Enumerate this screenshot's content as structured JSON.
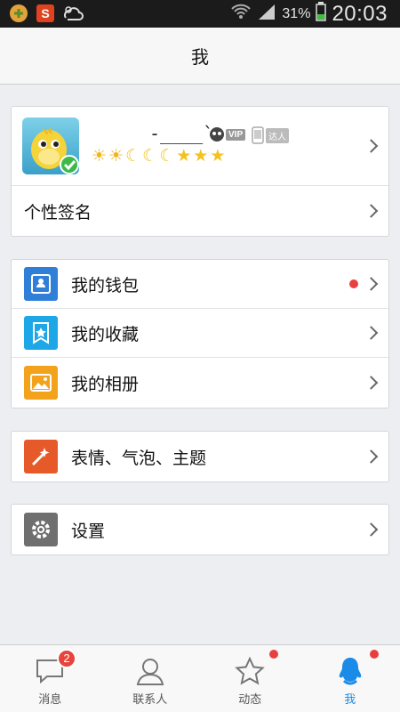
{
  "status_bar": {
    "battery_percent": "31%",
    "time": "20:03",
    "battery_level": 0.31
  },
  "header": {
    "title": "我"
  },
  "profile": {
    "nickname": "-____`",
    "vip_badge": "VIP",
    "talent_badge": "达人",
    "signature_label": "个性签名"
  },
  "menu": {
    "wallet": "我的钱包",
    "favorites": "我的收藏",
    "album": "我的相册",
    "emoji_themes": "表情、气泡、主题",
    "settings": "设置"
  },
  "tabs": [
    {
      "label": "消息",
      "icon": "message-icon",
      "badge": "2"
    },
    {
      "label": "联系人",
      "icon": "contacts-icon"
    },
    {
      "label": "动态",
      "icon": "star-icon",
      "dot": true
    },
    {
      "label": "我",
      "icon": "penguin-icon",
      "dot": true,
      "active": true
    }
  ],
  "colors": {
    "accent": "#1a8ce8",
    "wallet_icon_bg": "#2f7fd8",
    "favorites_icon_bg": "#1ea7e6",
    "album_icon_bg": "#f3a21b",
    "emoji_icon_bg": "#e65a2a",
    "settings_icon_bg": "#6f6f6f",
    "badge_red": "#e84040"
  }
}
